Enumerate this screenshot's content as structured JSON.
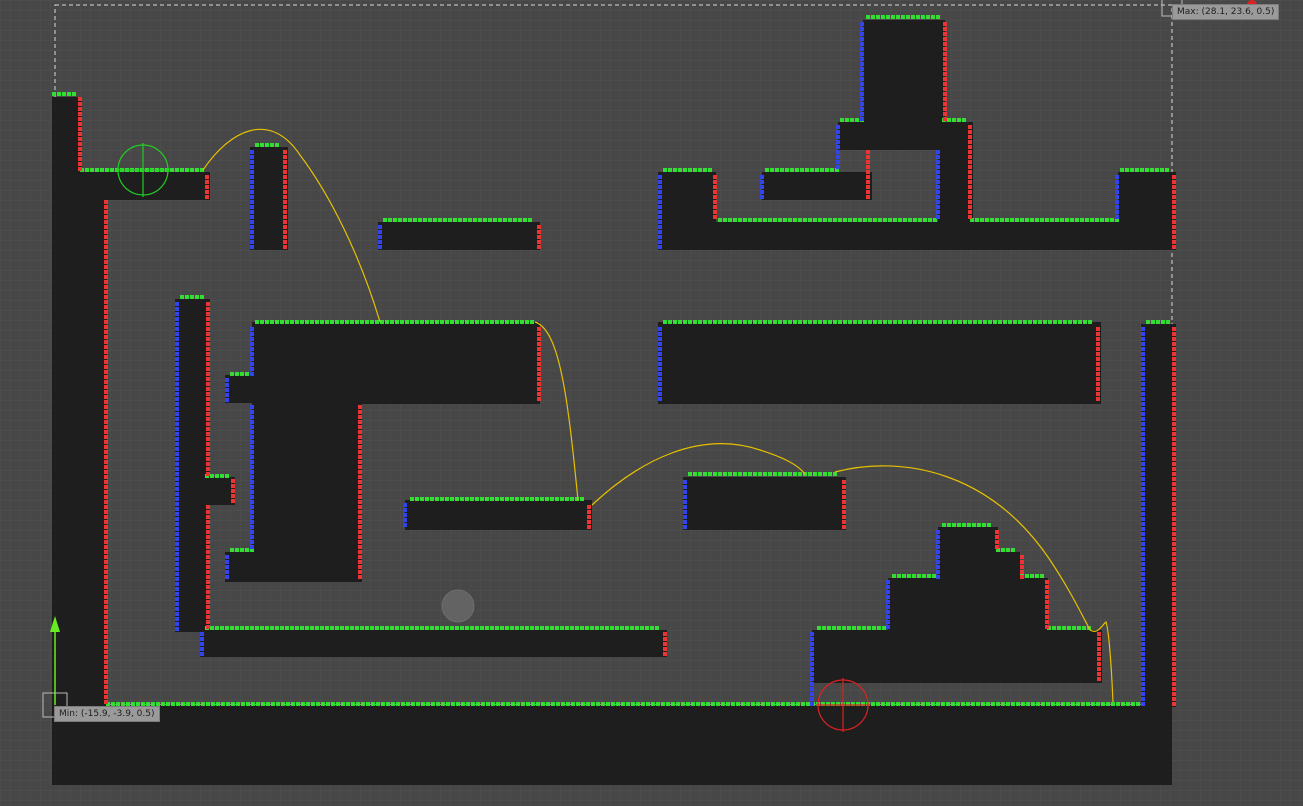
{
  "bounds": {
    "max_label": "Max: (28.1, 23.6, 0.5)",
    "min_label": "Min: (-15.9, -3.9, 0.5)"
  },
  "colors": {
    "background": "#474747",
    "grid": "#515151",
    "solid": "#1e1e1e",
    "edge_top": "#33dd33",
    "edge_left": "#3344ee",
    "edge_right": "#ee3333",
    "corner_cyan": "#33cccc",
    "corner_yellow": "#dddd33",
    "trajectory": "#e8c200",
    "start_marker": "#22cc22",
    "end_marker": "#dd2222",
    "bounds": "#dddddd",
    "axis_up": "#66ee22"
  },
  "markers": {
    "start": "crosshair-start",
    "end": "crosshair-end",
    "agent": "agent-circle"
  }
}
